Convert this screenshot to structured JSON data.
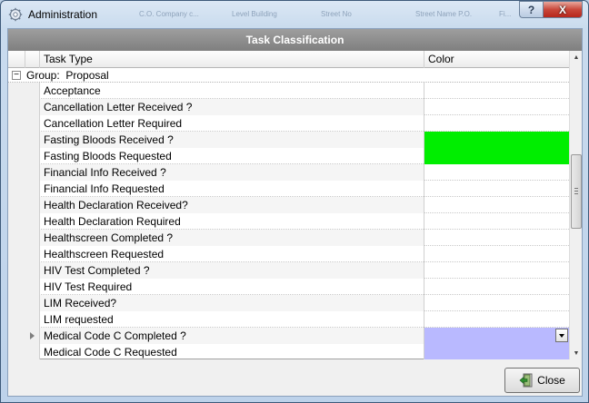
{
  "window": {
    "title": "Administration",
    "ghost_title_parts": [
      "C.O. Company c...",
      "Level Building",
      "Street No",
      "Street Name P.O.",
      "Fi..."
    ],
    "help_label": "?",
    "close_label": "X"
  },
  "grid": {
    "header": "Task Classification",
    "columns": {
      "task_type": "Task Type",
      "color": "Color"
    },
    "group": {
      "prefix": "Group:",
      "name": "Proposal",
      "expander": "−"
    },
    "rows": [
      {
        "task": "Acceptance",
        "color": ""
      },
      {
        "task": "Cancellation Letter Received ?",
        "color": ""
      },
      {
        "task": "Cancellation Letter Required",
        "color": ""
      },
      {
        "task": "Fasting Bloods Received ?",
        "color": "#00ee00"
      },
      {
        "task": "Fasting Bloods Requested",
        "color": "#00ee00"
      },
      {
        "task": "Financial Info Received ?",
        "color": ""
      },
      {
        "task": "Financial Info Requested",
        "color": ""
      },
      {
        "task": "Health Declaration Received?",
        "color": ""
      },
      {
        "task": "Health Declaration Required",
        "color": ""
      },
      {
        "task": "Healthscreen Completed ?",
        "color": ""
      },
      {
        "task": "Healthscreen Requested",
        "color": ""
      },
      {
        "task": "HIV Test Completed ?",
        "color": ""
      },
      {
        "task": "HIV Test Required",
        "color": ""
      },
      {
        "task": "LIM Received?",
        "color": ""
      },
      {
        "task": "LIM requested",
        "color": ""
      },
      {
        "task": "Medical Code C Completed ?",
        "color": "#b9b9ff",
        "current": true
      },
      {
        "task": "Medical Code C Requested",
        "color": "#b9b9ff"
      }
    ]
  },
  "footer": {
    "close_button": "Close"
  }
}
